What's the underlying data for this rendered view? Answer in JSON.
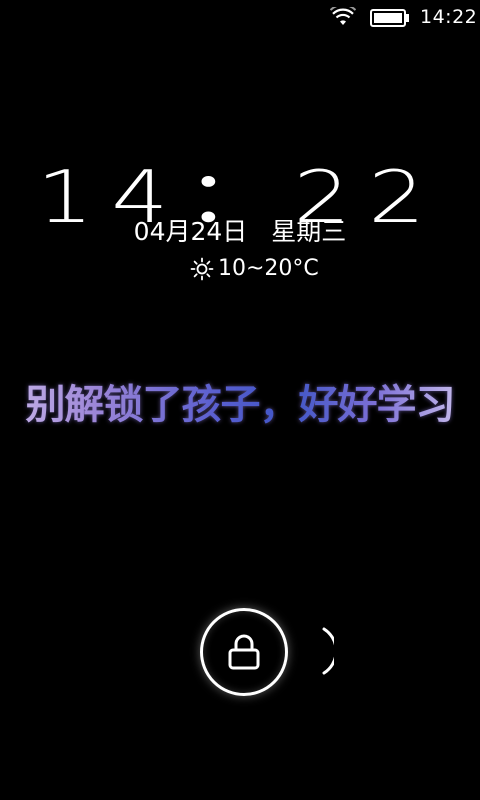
{
  "status_bar": {
    "time": "14:22",
    "icons": [
      "wifi-icon",
      "battery-icon"
    ]
  },
  "lockscreen": {
    "clock": "14：22",
    "date": "04月24日",
    "weekday": "星期三",
    "weather": {
      "icon": "sun-icon",
      "temperature": "10~20°C"
    },
    "slogan": "别解锁了孩子，好好学习",
    "unlock_icon": "lock-icon",
    "slide_hint_icon": "arc-hint-icon"
  }
}
